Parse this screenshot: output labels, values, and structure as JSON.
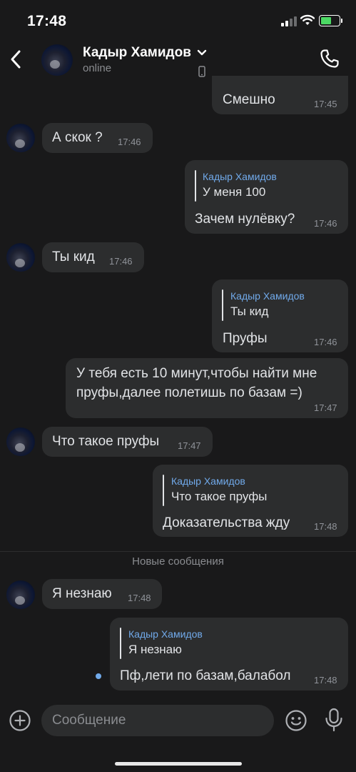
{
  "status_bar": {
    "time": "17:48"
  },
  "header": {
    "contact_name": "Кадыр Хамидов",
    "status": "online"
  },
  "messages": [
    {
      "side": "out",
      "text": "Смешно",
      "time": "17:45"
    },
    {
      "side": "in",
      "text": "А скок ?",
      "time": "17:46"
    },
    {
      "side": "out",
      "reply_to": {
        "name": "Кадыр Хамидов",
        "text": "У меня 100"
      },
      "text": "Зачем нулёвку?",
      "time": "17:46"
    },
    {
      "side": "in",
      "text": "Ты кид",
      "time": "17:46"
    },
    {
      "side": "out",
      "reply_to": {
        "name": "Кадыр Хамидов",
        "text": "Ты кид"
      },
      "text": "Пруфы",
      "time": "17:46"
    },
    {
      "side": "out",
      "text": "У тебя есть 10 минут,чтобы найти мне пруфы,далее полетишь по базам =)",
      "time": "17:47"
    },
    {
      "side": "in",
      "text": "Что такое пруфы",
      "time": "17:47"
    },
    {
      "side": "out",
      "reply_to": {
        "name": "Кадыр Хамидов",
        "text": "Что такое пруфы"
      },
      "text": "Доказательства жду",
      "time": "17:48"
    },
    {
      "side": "in",
      "text": "Я незнаю",
      "time": "17:48"
    },
    {
      "side": "out",
      "reply_to": {
        "name": "Кадыр Хамидов",
        "text": "Я незнаю"
      },
      "text": "Пф,лети по базам,балабол",
      "time": "17:48",
      "unread": true
    }
  ],
  "new_messages_divider": "Новые сообщения",
  "composer": {
    "placeholder": "Сообщение"
  },
  "colors": {
    "background": "#19191a",
    "bubble": "#2c2d2e",
    "accent": "#71aaeb",
    "battery": "#4cd964"
  }
}
